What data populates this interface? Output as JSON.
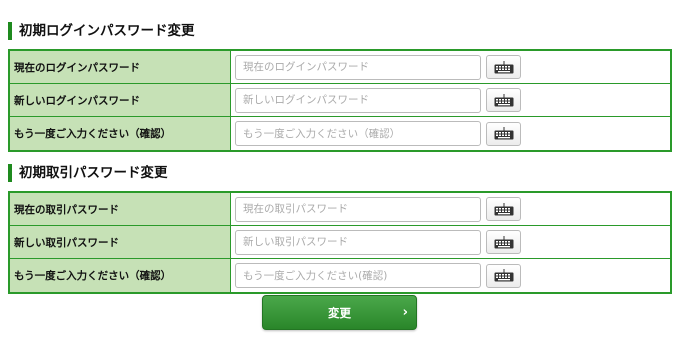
{
  "login_section": {
    "title": "初期ログインパスワード変更",
    "rows": [
      {
        "label": "現在のログインパスワード",
        "placeholder": "現在のログインパスワード"
      },
      {
        "label": "新しいログインパスワード",
        "placeholder": "新しいログインパスワード"
      },
      {
        "label": "もう一度ご入力ください（確認）",
        "placeholder": "もう一度ご入力ください（確認）"
      }
    ]
  },
  "trade_section": {
    "title": "初期取引パスワード変更",
    "rows": [
      {
        "label": "現在の取引パスワード",
        "placeholder": "現在の取引パスワード"
      },
      {
        "label": "新しい取引パスワード",
        "placeholder": "新しい取引パスワード"
      },
      {
        "label": "もう一度ご入力ください（確認）",
        "placeholder": "もう一度ご入力ください(確認)"
      }
    ]
  },
  "submit": {
    "label": "変更",
    "arrow": "›"
  },
  "icons": {
    "keyboard": "keyboard-icon"
  },
  "colors": {
    "accent": "#2a9a2a",
    "label_bg": "#c6e1b6",
    "button": "#3a983a"
  }
}
